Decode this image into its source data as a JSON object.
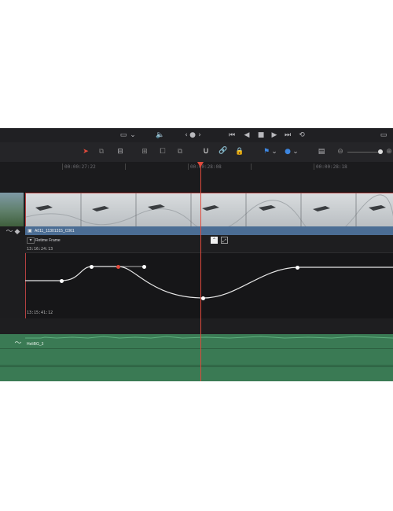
{
  "timeline": {
    "timecodes": [
      "00:00:27:22",
      "00:00:28:08",
      "00:00:28:18"
    ],
    "clip_name": "A011_11301315_C061",
    "retime_label": "Retime Frame",
    "retime_top_value": "13:16:24:13",
    "retime_bottom_value": "13:15:41:12",
    "audio_clip_name": "HeliBG_3"
  },
  "icons": {
    "top": [
      "viewer-layout-icon",
      "speaker-icon",
      "prev-arrow-icon",
      "dot-icon",
      "next-arrow-icon",
      "go-start-icon",
      "step-back-icon",
      "stop-icon",
      "play-icon",
      "go-end-icon",
      "loop-icon",
      "fullscreen-icon"
    ],
    "toolbar": [
      "selection-arrow-icon",
      "trim-icon",
      "blade-icon",
      "insert-icon",
      "overwrite-icon",
      "replace-icon",
      "snap-magnet-icon",
      "link-icon",
      "lock-icon",
      "flag-icon",
      "marker-icon",
      "track-height-icon",
      "zoom-out-icon",
      "zoom-in-icon"
    ]
  },
  "colors": {
    "playhead": "#e04a3c",
    "clip_header": "#4b6d94",
    "audio_track": "#3a7a54",
    "curve": "#e6e6e6"
  }
}
